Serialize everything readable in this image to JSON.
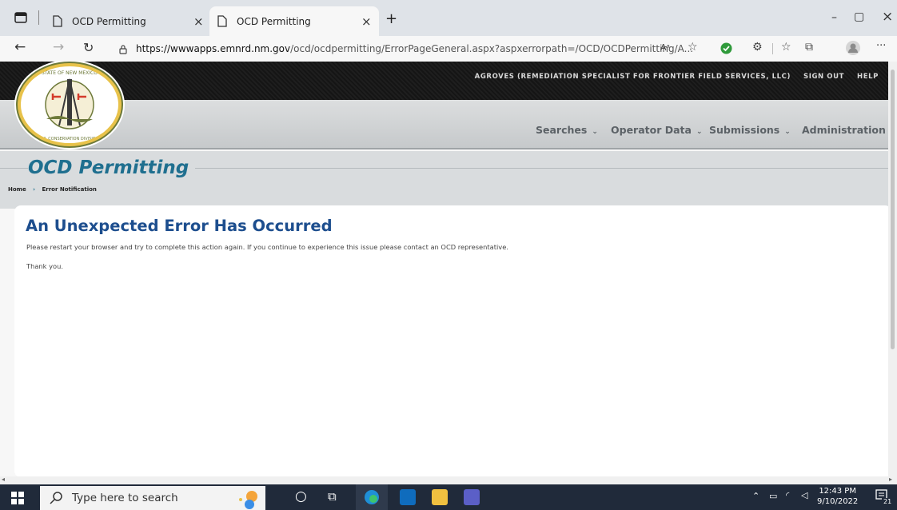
{
  "browser": {
    "tabs": [
      {
        "label": "OCD Permitting",
        "close": "×"
      },
      {
        "label": "OCD Permitting",
        "close": "×"
      }
    ],
    "new_tab": "+",
    "window_controls": {
      "minimize": "–",
      "maximize": "▢",
      "close": "×"
    },
    "url_host": "https://wwwapps.emnrd.nm.gov",
    "url_path": "/ocd/ocdpermitting/ErrorPageGeneral.aspx?aspxerrorpath=/OCD/OCDPermitting/A...",
    "read_aloud": "Aᵃ",
    "more": "···"
  },
  "site": {
    "seal_text": "STATE OF NEW MEXICO · OIL CONSERVATION DIVISION",
    "user_label": "AGROVES (REMEDIATION SPECIALIST FOR FRONTIER FIELD SERVICES, LLC)",
    "sign_out": "SIGN OUT",
    "help": "HELP",
    "nav": [
      {
        "label": "Searches"
      },
      {
        "label": "Operator Data"
      },
      {
        "label": "Submissions"
      },
      {
        "label": "Administration"
      }
    ],
    "page_title": "OCD Permitting",
    "breadcrumb": {
      "home": "Home",
      "sep": "›",
      "current": "Error Notification"
    }
  },
  "content": {
    "heading": "An Unexpected Error Has Occurred",
    "message": "Please restart your browser and try to complete this action again. If you continue to experience this issue please contact an OCD representative.",
    "thanks": "Thank you."
  },
  "taskbar": {
    "search_placeholder": "Type here to search",
    "time": "12:43 PM",
    "date": "9/10/2022",
    "notifications": "21"
  },
  "colors": {
    "title_teal": "#1f6f8f",
    "heading_blue": "#1d4e8e",
    "topbar": "#1a1a1a",
    "taskbar": "#202a3a"
  }
}
